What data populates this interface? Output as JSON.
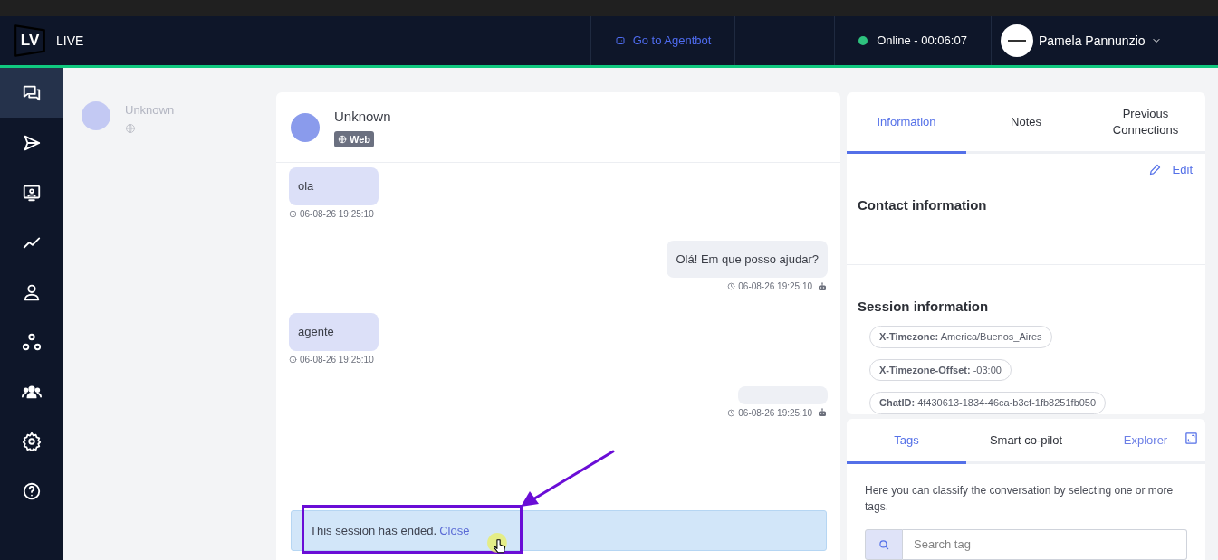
{
  "header": {
    "logo": "LV",
    "app_name": "LIVE",
    "agentbot_link": "Go to Agentbot",
    "status": {
      "label": "Online - 00:06:07",
      "online": true
    },
    "user_name": "Pamela Pannunzio"
  },
  "nav": [
    {
      "kind": "chats",
      "selected": true
    },
    {
      "kind": "send",
      "selected": false
    },
    {
      "kind": "monitor",
      "selected": false
    },
    {
      "kind": "chart",
      "selected": false
    },
    {
      "kind": "user",
      "selected": false
    },
    {
      "kind": "nodes",
      "selected": false
    },
    {
      "kind": "team",
      "selected": false
    },
    {
      "kind": "settings",
      "selected": false
    },
    {
      "kind": "help",
      "selected": false
    }
  ],
  "conversations": [
    {
      "name": "Unknown"
    }
  ],
  "chat": {
    "contact_name": "Unknown",
    "channel": "Web",
    "messages": [
      {
        "kind": "contact",
        "text": "ola",
        "time": "06-08-26 19:25:10"
      },
      {
        "kind": "bot",
        "text": "Olá! Em que posso ajudar?",
        "time": "06-08-26 19:25:10"
      },
      {
        "kind": "contact",
        "text": "agente",
        "time": "06-08-26 19:25:10"
      },
      {
        "kind": "bot",
        "time": "06-08-26 19:25:10"
      }
    ],
    "banner": {
      "text": "This session has ended.",
      "link": "Close"
    }
  },
  "info_panel": {
    "tabs": [
      {
        "label": "Information",
        "selected": true
      },
      {
        "label": "Notes",
        "selected": false
      },
      {
        "label": "Previous Connections",
        "selected": false
      }
    ],
    "edit": "Edit",
    "contact_heading": "Contact information",
    "session_heading": "Session information",
    "session_fields": [
      {
        "key": "X-Timezone:",
        "value": "America/Buenos_Aires"
      },
      {
        "key": "X-Timezone-Offset:",
        "value": "-03:00"
      },
      {
        "key": "ChatID:",
        "value": "4f430613-1834-46ca-b3cf-1fb8251fb050"
      }
    ]
  },
  "tools_panel": {
    "tabs": [
      {
        "label": "Tags",
        "selected": true
      },
      {
        "label": "Smart co-pilot",
        "selected": false
      },
      {
        "label": "Explorer",
        "selected": false
      }
    ],
    "description": "Here you can classify the conversation by selecting one or more tags.",
    "search": {
      "placeholder": "Search tag"
    }
  }
}
